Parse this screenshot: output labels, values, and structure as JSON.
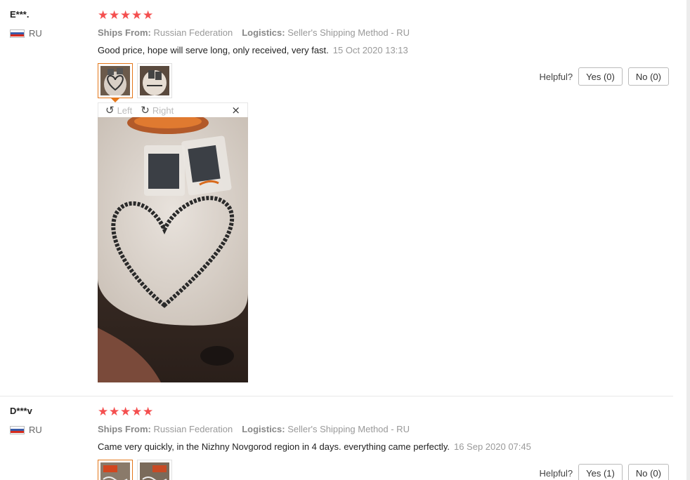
{
  "reviews": [
    {
      "user": "E***.",
      "country": "RU",
      "stars": [
        "★",
        "★",
        "★",
        "★",
        "★"
      ],
      "ships_from_label": "Ships From:",
      "ships_from_value": "Russian Federation",
      "logistics_label": "Logistics:",
      "logistics_value": "Seller's Shipping Method - RU",
      "text": "Good price, hope will serve long, only received, very fast.",
      "date": "15 Oct 2020 13:13",
      "helpful_label": "Helpful?",
      "yes_label": "Yes (0)",
      "no_label": "No (0)"
    },
    {
      "user": "D***v",
      "country": "RU",
      "stars": [
        "★",
        "★",
        "★",
        "★",
        "★"
      ],
      "ships_from_label": "Ships From:",
      "ships_from_value": "Russian Federation",
      "logistics_label": "Logistics:",
      "logistics_value": "Seller's Shipping Method - RU",
      "text": "Came very quickly, in the Nizhny Novgorod region in 4 days. everything came perfectly.",
      "date": "16 Sep 2020 07:45",
      "helpful_label": "Helpful?",
      "yes_label": "Yes (1)",
      "no_label": "No (0)"
    }
  ],
  "viewer": {
    "rotate_left_label": "Left",
    "rotate_right_label": "Right",
    "rotate_left_icon": "↺",
    "rotate_right_icon": "↻",
    "close_icon": "×"
  },
  "colors": {
    "star": "#f44f4f",
    "active_thumb_border": "#e4771a"
  }
}
